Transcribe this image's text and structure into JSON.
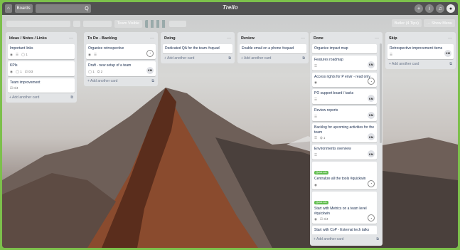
{
  "topbar": {
    "boards_label": "Boards",
    "search_icon": "Q",
    "logo": "Trello",
    "plus": "+",
    "info": "i",
    "bell": "♫"
  },
  "boardbar": {
    "visibility": "Team Visible",
    "butler": "Butler (4 Tips)",
    "show_menu": "··· Show Menu"
  },
  "lists": [
    {
      "title": "Ideas / Notes / Links",
      "add": "+ Add another card",
      "cards": [
        {
          "title": "Important links",
          "badges": [
            "◉",
            "☰",
            "◯ 1"
          ]
        },
        {
          "title": "KPIs",
          "badges": [
            "◉",
            "◯ 1",
            "☑ 0/3"
          ]
        },
        {
          "title": "Team improvement",
          "badges": [
            "☑ 0/4"
          ]
        }
      ]
    },
    {
      "title": "To Do - Backlog",
      "add": "+ Add another card",
      "cards": [
        {
          "title": "Organize retrospective",
          "badges": [
            "◉",
            "☰"
          ],
          "member": "pic"
        },
        {
          "title": "Draft - new setup of a team",
          "badges": [
            "◯ 1",
            "⛭ 2"
          ],
          "member": "KM"
        }
      ]
    },
    {
      "title": "Doing",
      "add": "+ Add another card",
      "cards": [
        {
          "title": "Dedicated QA for the team #squad",
          "badges": []
        }
      ]
    },
    {
      "title": "Review",
      "add": "+ Add another card",
      "cards": [
        {
          "title": "Enable email on a phone #squad",
          "badges": []
        }
      ]
    },
    {
      "title": "Done",
      "add": "+ Add another card",
      "cards": [
        {
          "title": "Organize impact map",
          "badges": []
        },
        {
          "title": "Features roadmap",
          "badges": [
            "☰"
          ],
          "member": "KM"
        },
        {
          "title": "Access rights for P envir - read only",
          "badges": [
            "◉"
          ],
          "member": "pic"
        },
        {
          "title": "PO support board / tasks",
          "badges": [
            "☰"
          ],
          "member": "KM"
        },
        {
          "title": "Review reports",
          "badges": [
            "☰"
          ],
          "member": "KM"
        },
        {
          "title": "Backlog for upcoming activities for the team",
          "badges": [
            "☰",
            "⛭ 1"
          ],
          "member": "KM"
        },
        {
          "title": "Environments overview",
          "badges": [
            "☰"
          ],
          "member": "KM"
        },
        {
          "title": "Centralize all the tools #quickwin",
          "label": "Quick win",
          "badges": [
            "◉"
          ],
          "member": "pic"
        },
        {
          "title": "Start with Metrics on a team level #quickwin",
          "label": "Quick win",
          "badges": [
            "◉",
            "☑ 3/4"
          ],
          "member": "pic"
        },
        {
          "title": "Start with CoP - External tech talks",
          "badges": []
        }
      ]
    },
    {
      "title": "Skip",
      "add": "+ Add another card",
      "cards": [
        {
          "title": "Retrospective improvement items",
          "badges": [
            "☰"
          ],
          "member": "KM"
        }
      ]
    }
  ]
}
